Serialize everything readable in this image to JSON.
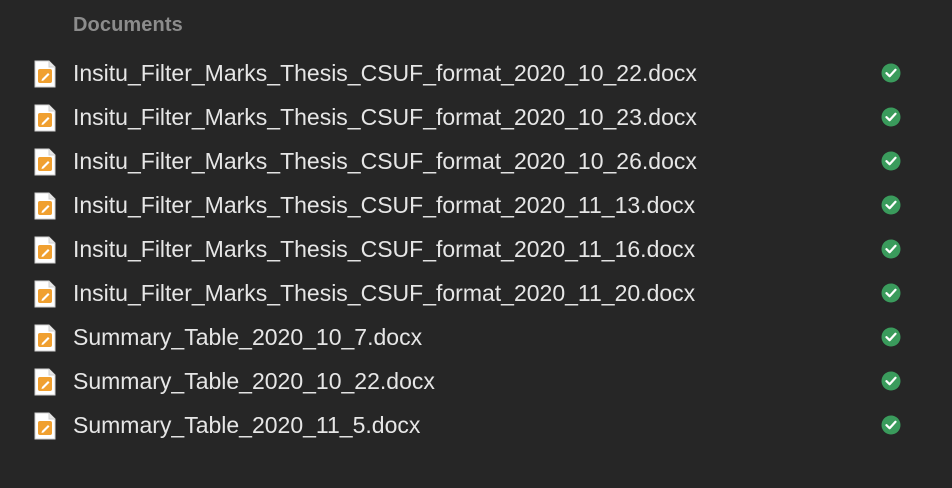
{
  "section": {
    "title": "Documents"
  },
  "files": [
    {
      "name": "Insitu_Filter_Marks_Thesis_CSUF_format_2020_10_22.docx",
      "icon": "docx-file-icon",
      "status": "synced-check-icon"
    },
    {
      "name": "Insitu_Filter_Marks_Thesis_CSUF_format_2020_10_23.docx",
      "icon": "docx-file-icon",
      "status": "synced-check-icon"
    },
    {
      "name": "Insitu_Filter_Marks_Thesis_CSUF_format_2020_10_26.docx",
      "icon": "docx-file-icon",
      "status": "synced-check-icon"
    },
    {
      "name": "Insitu_Filter_Marks_Thesis_CSUF_format_2020_11_13.docx",
      "icon": "docx-file-icon",
      "status": "synced-check-icon"
    },
    {
      "name": "Insitu_Filter_Marks_Thesis_CSUF_format_2020_11_16.docx",
      "icon": "docx-file-icon",
      "status": "synced-check-icon"
    },
    {
      "name": "Insitu_Filter_Marks_Thesis_CSUF_format_2020_11_20.docx",
      "icon": "docx-file-icon",
      "status": "synced-check-icon"
    },
    {
      "name": "Summary_Table_2020_10_7.docx",
      "icon": "docx-file-icon",
      "status": "synced-check-icon"
    },
    {
      "name": "Summary_Table_2020_10_22.docx",
      "icon": "docx-file-icon",
      "status": "synced-check-icon"
    },
    {
      "name": "Summary_Table_2020_11_5.docx",
      "icon": "docx-file-icon",
      "status": "synced-check-icon"
    }
  ],
  "colors": {
    "background": "#262626",
    "header_text": "#8c8c8c",
    "file_text": "#e6e6e6",
    "doc_icon_orange": "#f0a030",
    "sync_green": "#3a9b5c"
  }
}
